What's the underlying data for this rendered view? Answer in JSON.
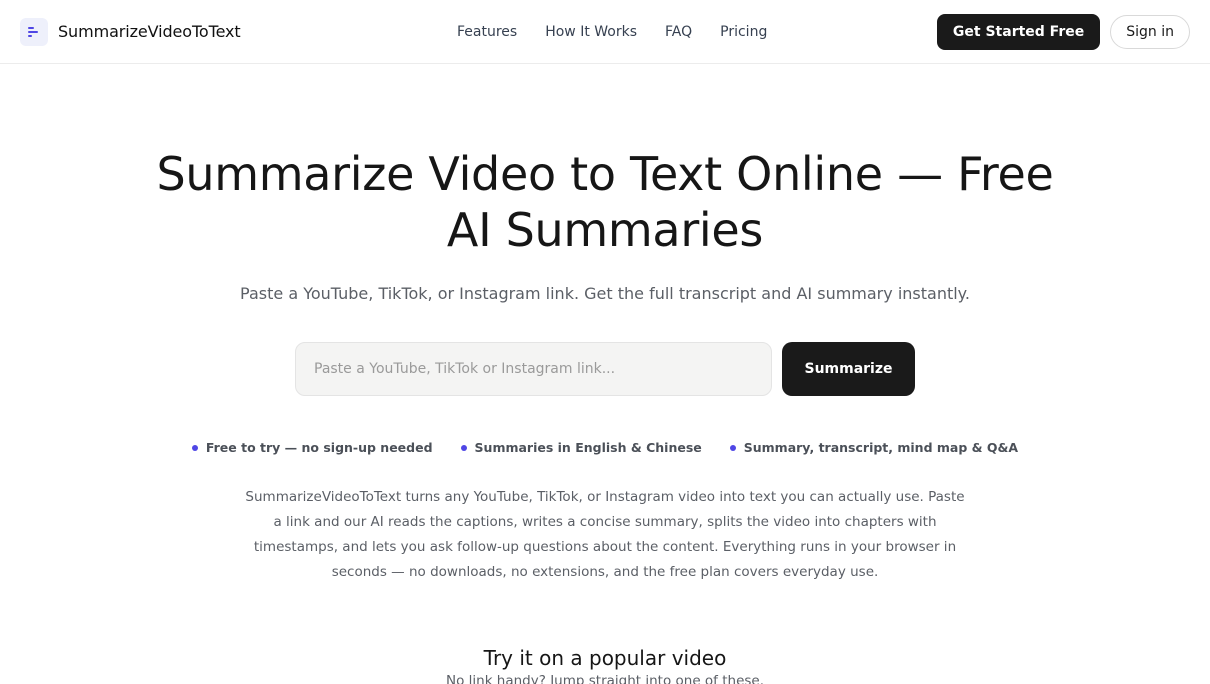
{
  "brand": {
    "name": "SummarizeVideoToText",
    "icon": "text-lines-icon",
    "accent": "#4f46e5"
  },
  "nav": {
    "items": [
      {
        "label": "Features"
      },
      {
        "label": "How It Works"
      },
      {
        "label": "FAQ"
      },
      {
        "label": "Pricing"
      }
    ]
  },
  "header": {
    "cta_label": "Get Started Free",
    "signin_label": "Sign in"
  },
  "hero": {
    "title": "Summarize Video to Text Online — Free AI Summaries",
    "subtitle": "Paste a YouTube, TikTok, or Instagram link. Get the full transcript and AI summary instantly.",
    "search": {
      "value": "",
      "placeholder": "Paste a YouTube, TikTok or Instagram link..."
    },
    "submit_label": "Summarize"
  },
  "features": [
    {
      "label": "Free to try — no sign-up needed"
    },
    {
      "label": "Summaries in English & Chinese"
    },
    {
      "label": "Summary, transcript, mind map & Q&A"
    }
  ],
  "description": "SummarizeVideoToText turns any YouTube, TikTok, or Instagram video into text you can actually use. Paste a link and our AI reads the captions, writes a concise summary, splits the video into chapters with timestamps, and lets you ask follow-up questions about the content. Everything runs in your browser in seconds — no downloads, no extensions, and the free plan covers everyday use.",
  "popular": {
    "title": "Try it on a popular video",
    "subtitle": "No link handy? Jump straight into one of these."
  },
  "colors": {
    "primary_dark": "#1a1a1a",
    "bullet": "#4f46e5",
    "muted_text": "#5b5f66"
  }
}
